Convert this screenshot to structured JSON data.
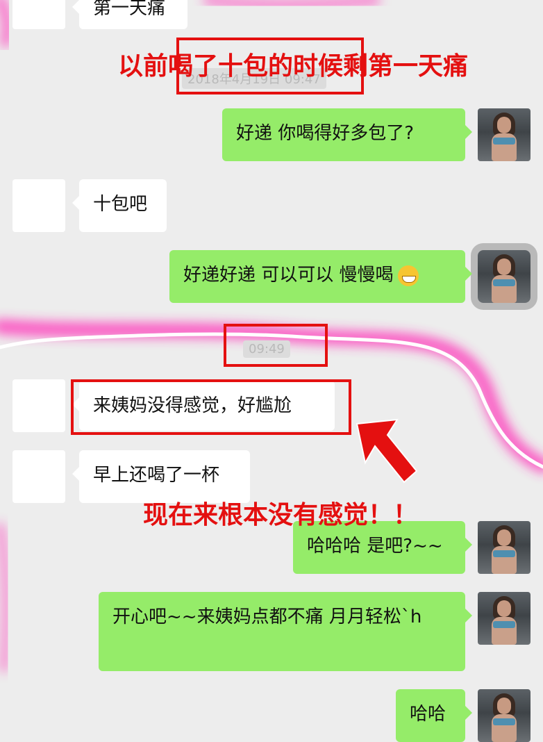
{
  "messages": [
    {
      "side": "left",
      "text": "第一天痛"
    },
    {
      "side": "right",
      "text": "好递 你喝得好多包了?"
    },
    {
      "side": "left",
      "text": "十包吧"
    },
    {
      "side": "right",
      "text": "好递好递 可以可以 慢慢喝"
    },
    {
      "side": "left",
      "text": "来姨妈没得感觉，好尴尬"
    },
    {
      "side": "left",
      "text": "早上还喝了一杯"
    },
    {
      "side": "right",
      "text": "哈哈哈 是吧?~~"
    },
    {
      "side": "right",
      "text": "开心吧~~来姨妈点都不痛  月月轻松`h"
    },
    {
      "side": "right",
      "text": "哈哈"
    }
  ],
  "timestamps": {
    "first": "2018年4月19日 09:47",
    "second": "09:49"
  },
  "annotations": {
    "top": "以前喝了十包的时候剩第一天痛",
    "middle": "现在来根本没有感觉！！"
  },
  "icons": {
    "emoji": "grinning-face-icon",
    "arrow": "red-arrow-icon"
  },
  "colors": {
    "background": "#ededed",
    "bubble_green": "#95ec69",
    "bubble_white": "#ffffff",
    "annotation_red": "#e41010",
    "glow_pink": "#ff2fb7"
  }
}
